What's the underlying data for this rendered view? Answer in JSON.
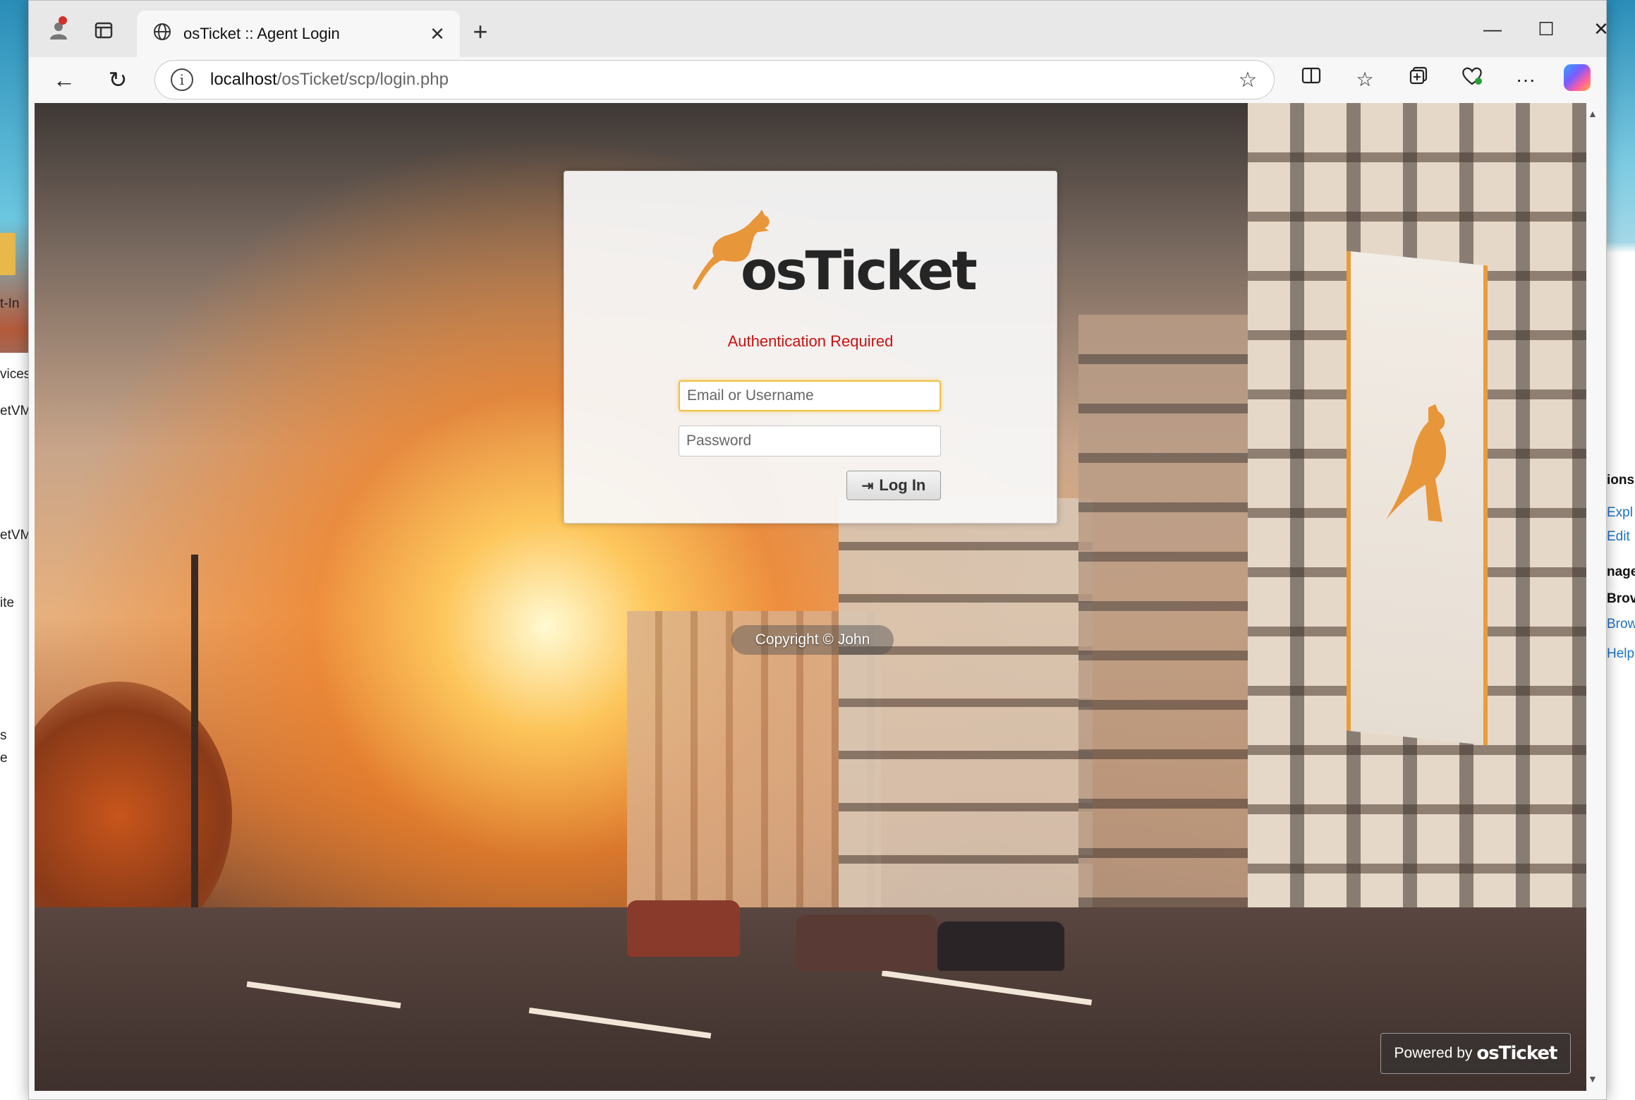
{
  "desktop": {
    "left_texts": [
      "t-In",
      "vices",
      "etVM",
      "etVM",
      "ite",
      "s",
      "e"
    ],
    "right_texts": [
      "ions",
      "Expl",
      "Edit",
      "nage",
      "Brov",
      "Brow",
      "Help"
    ]
  },
  "browser": {
    "tab_title": "osTicket :: Agent Login",
    "url_host": "localhost",
    "url_path": "/osTicket/scp/login.php",
    "icons": {
      "profile": "profile-icon",
      "tab_actions": "tab-actions-icon",
      "globe": "globe-icon",
      "close_tab": "close-icon",
      "new_tab": "plus-icon",
      "minimize": "minimize-icon",
      "maximize": "maximize-icon",
      "close_window": "close-icon",
      "back": "back-arrow-icon",
      "refresh": "refresh-icon",
      "site_info": "info-icon",
      "favorite": "star-icon",
      "split_screen": "split-screen-icon",
      "favorites": "favorites-icon",
      "collections": "collections-icon",
      "browser_essentials": "heart-pulse-icon",
      "more": "more-icon",
      "copilot": "copilot-icon"
    }
  },
  "login": {
    "logo_text": "osTicket",
    "auth_message": "Authentication Required",
    "username_placeholder": "Email or Username",
    "password_placeholder": "Password",
    "login_button": "Log In",
    "accent_color": "#e8963a",
    "error_color": "#cc1111"
  },
  "footer": {
    "copyright": "Copyright © John",
    "powered_by_label": "Powered by",
    "powered_by_logo": "osTicket"
  }
}
